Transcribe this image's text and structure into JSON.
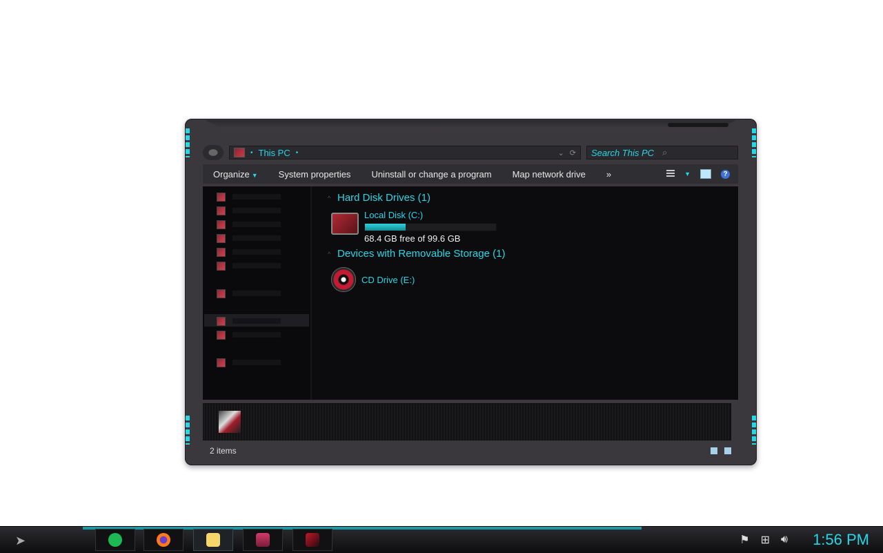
{
  "window": {
    "address": {
      "location": "This PC",
      "search_placeholder": "Search This PC"
    },
    "toolbar": {
      "organize": "Organize",
      "system_properties": "System properties",
      "uninstall": "Uninstall or change a program",
      "map_drive": "Map network drive",
      "more": "»"
    },
    "groups": {
      "hdd_title": "Hard Disk Drives (1)",
      "removable_title": "Devices with Removable Storage (1)"
    },
    "local_disk": {
      "name": "Local Disk (C:)",
      "free_text": "68.4 GB free of 99.6 GB",
      "used_fraction": 0.31
    },
    "cd_drive": {
      "name": "CD Drive (E:)"
    },
    "status": {
      "item_count": "2 items"
    }
  },
  "taskbar": {
    "apps": [
      "spotify-icon",
      "firefox-icon",
      "file-explorer-icon",
      "this-pc-icon",
      "ssd-icon"
    ],
    "tray": [
      "flag-icon",
      "network-icon",
      "volume-icon"
    ],
    "clock": "1:56 PM"
  },
  "colors": {
    "accent": "#23d8e8",
    "window_bg": "#3a383d",
    "content_bg": "#0c0b0d"
  }
}
